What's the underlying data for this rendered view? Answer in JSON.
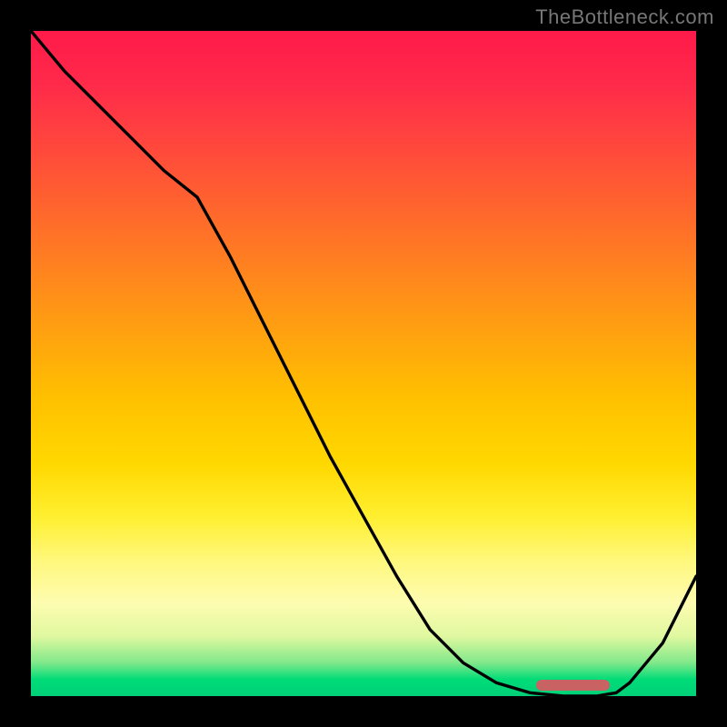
{
  "watermark": "TheBottleneck.com",
  "chart_data": {
    "type": "line",
    "x": [
      0.0,
      0.05,
      0.1,
      0.15,
      0.2,
      0.25,
      0.3,
      0.35,
      0.4,
      0.45,
      0.5,
      0.55,
      0.6,
      0.65,
      0.7,
      0.75,
      0.8,
      0.82,
      0.85,
      0.88,
      0.9,
      0.95,
      1.0
    ],
    "y": [
      1.0,
      0.94,
      0.89,
      0.84,
      0.79,
      0.75,
      0.66,
      0.56,
      0.46,
      0.36,
      0.27,
      0.18,
      0.1,
      0.05,
      0.02,
      0.005,
      0.0,
      0.0,
      0.0,
      0.005,
      0.02,
      0.08,
      0.18
    ],
    "title": "",
    "xlabel": "",
    "ylabel": "",
    "xlim": [
      0,
      1
    ],
    "ylim": [
      0,
      1
    ],
    "optimal_band": {
      "start": 0.76,
      "end": 0.87
    },
    "gradient_semantics": "top=bad(red) bottom=good(green)"
  },
  "colors": {
    "line": "#000000",
    "marker": "#c96262",
    "background": "#000000"
  }
}
